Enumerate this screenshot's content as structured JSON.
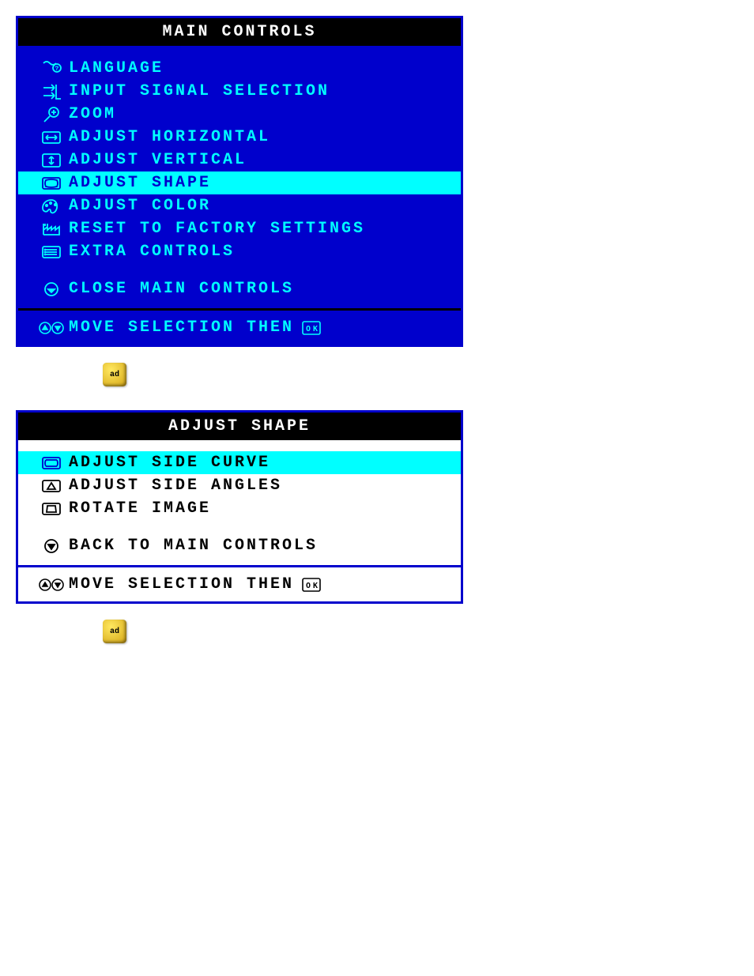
{
  "panel1": {
    "title": "MAIN CONTROLS",
    "items": [
      {
        "label": "LANGUAGE"
      },
      {
        "label": "INPUT SIGNAL SELECTION"
      },
      {
        "label": "ZOOM"
      },
      {
        "label": "ADJUST HORIZONTAL"
      },
      {
        "label": "ADJUST VERTICAL"
      },
      {
        "label": "ADJUST SHAPE"
      },
      {
        "label": "ADJUST COLOR"
      },
      {
        "label": "RESET TO FACTORY SETTINGS"
      },
      {
        "label": "EXTRA CONTROLS"
      }
    ],
    "close": "CLOSE MAIN CONTROLS",
    "footer": "MOVE SELECTION THEN"
  },
  "panel2": {
    "title": "ADJUST SHAPE",
    "items": [
      {
        "label": "ADJUST SIDE CURVE"
      },
      {
        "label": "ADJUST SIDE ANGLES"
      },
      {
        "label": "ROTATE IMAGE"
      }
    ],
    "back": "BACK TO MAIN CONTROLS",
    "footer": "MOVE SELECTION THEN"
  },
  "ok_label": "ad"
}
